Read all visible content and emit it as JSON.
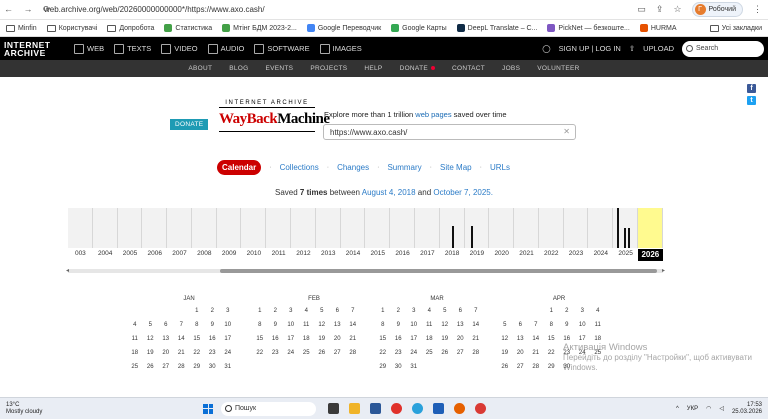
{
  "browser": {
    "url": "web.archive.org/web/20260000000000*/https://www.axo.cash/",
    "profile_initial": "Г",
    "profile_name": "Робочий"
  },
  "bookmarks": {
    "items": [
      "Minfin",
      "Користувачі",
      "Допробота",
      "Статистика",
      "Мтінг БДМ 2023-2...",
      "Google Переводчик",
      "Google Карты",
      "DeepL Translate – C...",
      "PickNet — безкоште...",
      "HURMA"
    ],
    "all_label": "Усі закладки"
  },
  "ia_header": {
    "logo_line1": "INTERNET",
    "logo_line2": "ARCHIVE",
    "media": [
      "WEB",
      "TEXTS",
      "VIDEO",
      "AUDIO",
      "SOFTWARE",
      "IMAGES"
    ],
    "signup": "SIGN UP | LOG IN",
    "upload": "UPLOAD",
    "search_placeholder": "Search"
  },
  "ia_subnav": [
    "ABOUT",
    "BLOG",
    "EVENTS",
    "PROJECTS",
    "HELP",
    "DONATE",
    "CONTACT",
    "JOBS",
    "VOLUNTEER"
  ],
  "wayback": {
    "donate": "DONATE",
    "logo_top": "INTERNET ARCHIVE",
    "logo_way": "WayBack",
    "logo_mach": "Machine",
    "explore_pre": "Explore more than 1 trillion ",
    "explore_link": "web pages",
    "explore_post": " saved over time",
    "url_value": "https://www.axo.cash/"
  },
  "tabs": [
    "Calendar",
    "Collections",
    "Changes",
    "Summary",
    "Site Map",
    "URLs"
  ],
  "saved": {
    "pre": "Saved ",
    "count": "7 times",
    "mid": " between ",
    "start": "August 4, 2018",
    "and": " and ",
    "end": "October 7, 2025."
  },
  "timeline": {
    "years": [
      "003",
      "2004",
      "2005",
      "2006",
      "2007",
      "2008",
      "2009",
      "2010",
      "2011",
      "2012",
      "2013",
      "2014",
      "2015",
      "2016",
      "2017",
      "2018",
      "2019",
      "2020",
      "2021",
      "2022",
      "2023",
      "2024",
      "2025",
      "2026"
    ],
    "selected_year": "2026",
    "captures": [
      {
        "year": "2018",
        "level": 0.55
      },
      {
        "year": "2019",
        "level": 0.55
      },
      {
        "year": "2025",
        "level": 1.0
      },
      {
        "year": "2025",
        "level": 0.5
      },
      {
        "year": "2025",
        "level": 0.5
      }
    ]
  },
  "months": [
    {
      "name": "JAN",
      "rows": [
        [
          "",
          "",
          "",
          "",
          "1",
          "2",
          "3"
        ],
        [
          "4",
          "5",
          "6",
          "7",
          "8",
          "9",
          "10"
        ],
        [
          "11",
          "12",
          "13",
          "14",
          "15",
          "16",
          "17"
        ],
        [
          "18",
          "19",
          "20",
          "21",
          "22",
          "23",
          "24"
        ],
        [
          "25",
          "26",
          "27",
          "28",
          "29",
          "30",
          "31"
        ]
      ]
    },
    {
      "name": "FEB",
      "rows": [
        [
          "1",
          "2",
          "3",
          "4",
          "5",
          "6",
          "7"
        ],
        [
          "8",
          "9",
          "10",
          "11",
          "12",
          "13",
          "14"
        ],
        [
          "15",
          "16",
          "17",
          "18",
          "19",
          "20",
          "21"
        ],
        [
          "22",
          "23",
          "24",
          "25",
          "26",
          "27",
          "28"
        ],
        [
          "",
          "",
          "",
          "",
          "",
          "",
          ""
        ]
      ]
    },
    {
      "name": "MAR",
      "rows": [
        [
          "1",
          "2",
          "3",
          "4",
          "5",
          "6",
          "7"
        ],
        [
          "8",
          "9",
          "10",
          "11",
          "12",
          "13",
          "14"
        ],
        [
          "15",
          "16",
          "17",
          "18",
          "19",
          "20",
          "21"
        ],
        [
          "22",
          "23",
          "24",
          "25",
          "26",
          "27",
          "28"
        ],
        [
          "29",
          "30",
          "31",
          "",
          "",
          "",
          ""
        ]
      ]
    },
    {
      "name": "APR",
      "rows": [
        [
          "",
          "",
          "",
          "1",
          "2",
          "3",
          "4"
        ],
        [
          "5",
          "6",
          "7",
          "8",
          "9",
          "10",
          "11"
        ],
        [
          "12",
          "13",
          "14",
          "15",
          "16",
          "17",
          "18"
        ],
        [
          "19",
          "20",
          "21",
          "22",
          "23",
          "24",
          "25"
        ],
        [
          "26",
          "27",
          "28",
          "29",
          "30",
          "",
          ""
        ]
      ]
    }
  ],
  "watermark": {
    "line1": "Активація Windows",
    "line2": "Перейдіть до розділу \"Настройки\", щоб активувати",
    "line3": "Windows."
  },
  "taskbar": {
    "temp": "13°C",
    "weather": "Mostly cloudy",
    "search": "Пошук",
    "lang": "УКР",
    "time": "17:53",
    "date": "25.03.2026"
  },
  "colors": {
    "calendar_tab": "#cc0000",
    "link": "#2b7bc7",
    "selected_year": "#fffa8f",
    "donate_teal": "#1e9bb4"
  }
}
